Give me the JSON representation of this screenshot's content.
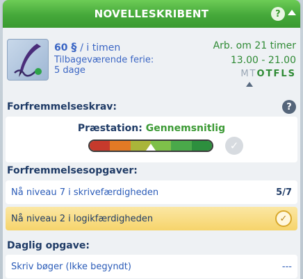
{
  "header": {
    "title": "Novelleskribent",
    "help_label": "?"
  },
  "job": {
    "pay_amount": "60",
    "pay_symbol": "§",
    "pay_unit": "/ i timen",
    "vacation_label": "Tilbageværende ferie:",
    "vacation_value": "5 dage",
    "work_in": "Arb. om 21 timer",
    "work_hours": "13.00 - 21.00",
    "days": [
      {
        "letter": "M",
        "active": false
      },
      {
        "letter": "T",
        "active": false
      },
      {
        "letter": "O",
        "active": true
      },
      {
        "letter": "T",
        "active": true
      },
      {
        "letter": "F",
        "active": true
      },
      {
        "letter": "L",
        "active": true
      },
      {
        "letter": "S",
        "active": true
      }
    ]
  },
  "promotion": {
    "title": "Forfremmelseskrav:",
    "help_label": "?",
    "performance_label": "Præstation:",
    "performance_value": "Gennemsnitlig",
    "performance_level": 0.5,
    "bar_colors": [
      "#c63a2c",
      "#e37a25",
      "#a9b53a",
      "#7ec04a",
      "#4aa94a",
      "#2d8f3e"
    ]
  },
  "tasks": {
    "title": "Forfremmelsesopgaver:",
    "items": [
      {
        "label": "Nå niveau 7 i skrivefærdigheden",
        "progress": "5/7",
        "done": false
      },
      {
        "label": "Nå niveau 2 i logikfærdigheden",
        "progress": "",
        "done": true
      }
    ]
  },
  "daily": {
    "title": "Daglig opgave:",
    "label": "Skriv bøger (Ikke begyndt)",
    "progress": "---"
  },
  "colors": {
    "accent_green": "#45a83a",
    "link_blue": "#2a5bb8",
    "gold": "#f6d46b"
  }
}
